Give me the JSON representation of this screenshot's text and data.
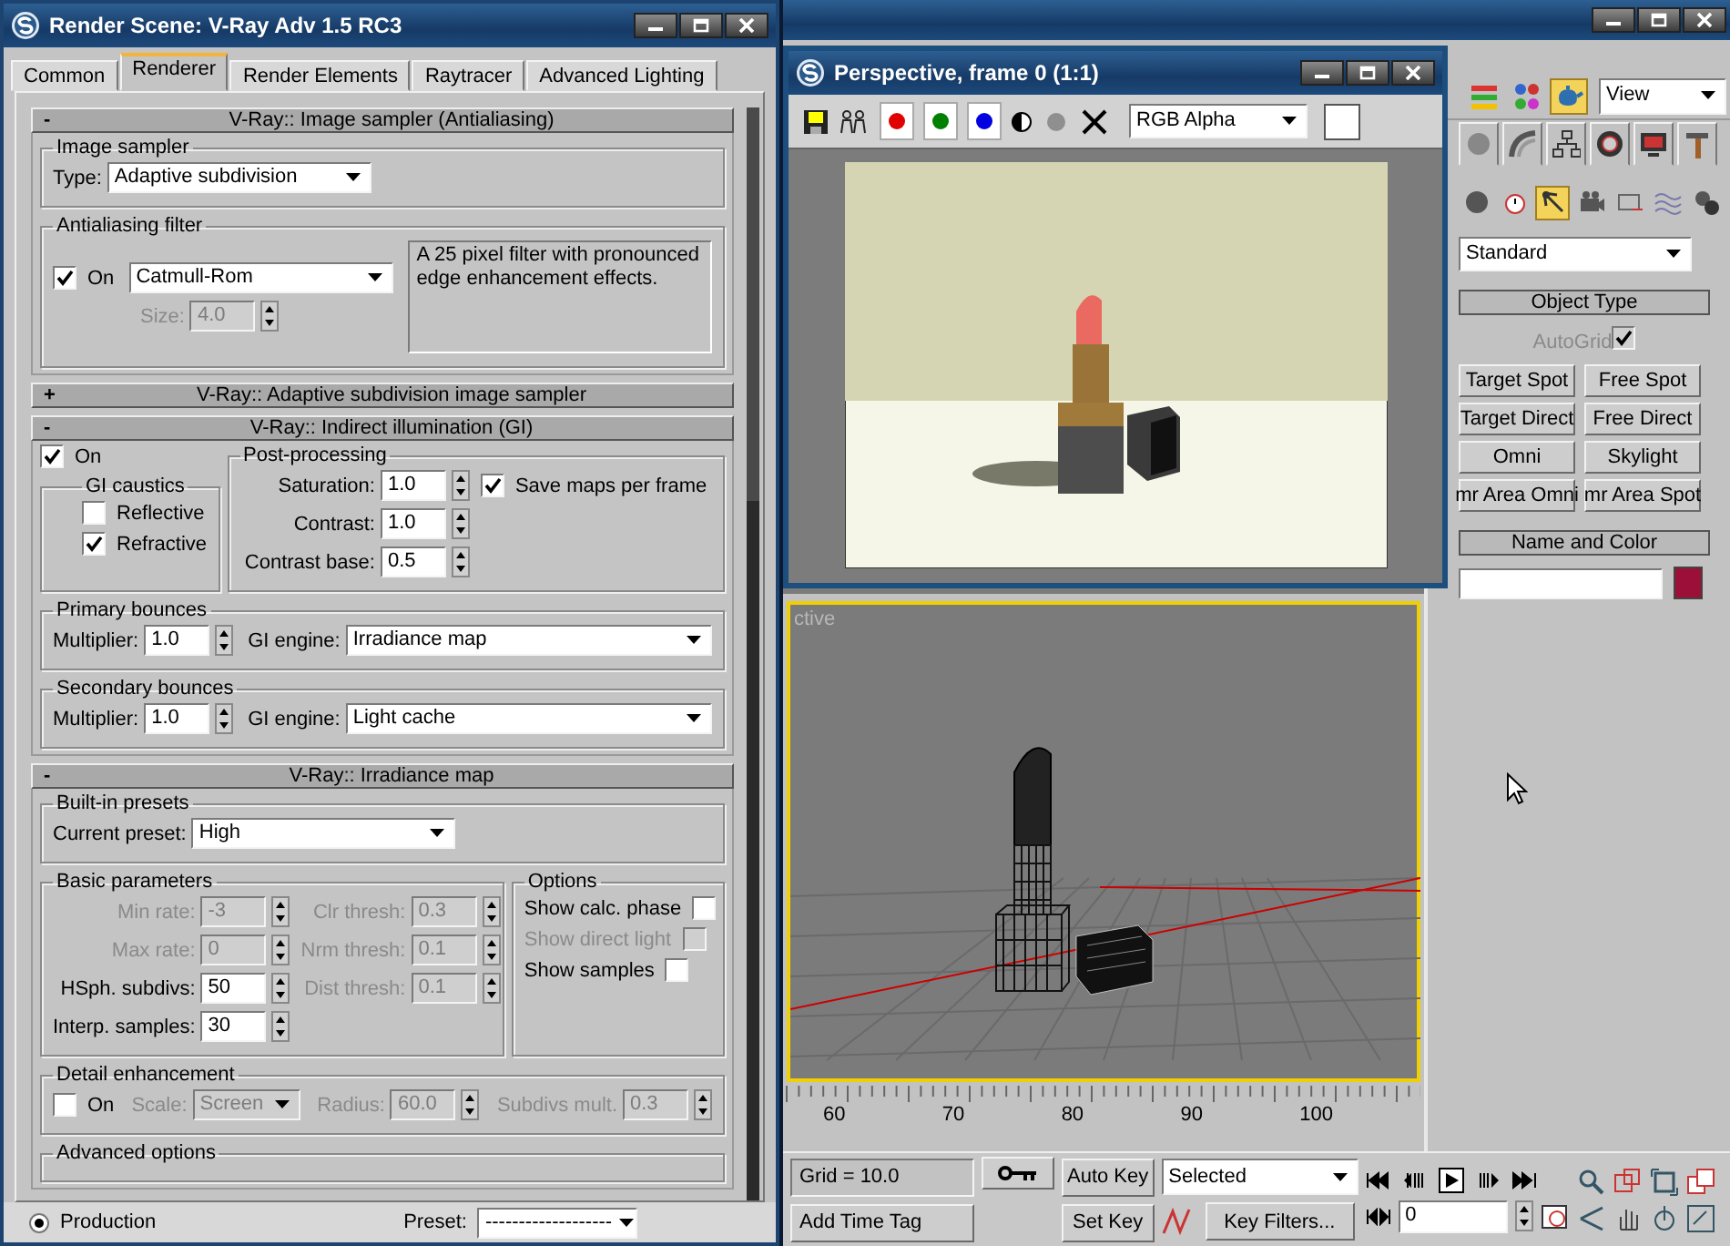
{
  "render_dialog": {
    "title": "Render Scene: V-Ray Adv 1.5 RC3",
    "tabs": [
      {
        "label": "Common",
        "selected": false
      },
      {
        "label": "Renderer",
        "selected": true
      },
      {
        "label": "Render Elements",
        "selected": false
      },
      {
        "label": "Raytracer",
        "selected": false
      },
      {
        "label": "Advanced Lighting",
        "selected": false
      }
    ],
    "rollouts": [
      {
        "toggle": "-",
        "title": "V-Ray:: Image sampler (Antialiasing)",
        "expanded": true,
        "items": [
          {
            "kind": "group",
            "title": "Image sampler",
            "items": [
              {
                "kind": "row",
                "items": [
                  {
                    "kind": "dropdown",
                    "label": "Type:",
                    "value": "Adaptive subdivision",
                    "disabled": false
                  }
                ]
              }
            ]
          },
          {
            "kind": "group",
            "title": "Antialiasing filter",
            "items": [
              {
                "kind": "row",
                "items": [
                  {
                    "kind": "col",
                    "items": [
                      {
                        "kind": "row",
                        "items": [
                          {
                            "kind": "checkbox",
                            "label": "On",
                            "checked": true,
                            "disabled": false
                          },
                          {
                            "kind": "dropdown",
                            "value": "Catmull-Rom",
                            "disabled": false
                          }
                        ]
                      },
                      {
                        "kind": "spinner",
                        "label": "Size:",
                        "value": "4.0",
                        "disabled": true
                      }
                    ]
                  },
                  {
                    "kind": "note",
                    "text": "A 25 pixel filter with pronounced edge enhancement effects."
                  }
                ]
              }
            ]
          }
        ]
      },
      {
        "toggle": "+",
        "title": "V-Ray:: Adaptive subdivision image sampler",
        "expanded": false
      },
      {
        "toggle": "-",
        "title": "V-Ray:: Indirect illumination (GI)",
        "expanded": true,
        "items": [
          {
            "kind": "row",
            "items": [
              {
                "kind": "col",
                "items": [
                  {
                    "kind": "checkbox",
                    "label": "On",
                    "checked": true,
                    "disabled": false
                  },
                  {
                    "kind": "group",
                    "title": "GI caustics",
                    "items": [
                      {
                        "kind": "checkbox",
                        "label": "Reflective",
                        "checked": false,
                        "disabled": false
                      },
                      {
                        "kind": "checkbox",
                        "label": "Refractive",
                        "checked": true,
                        "disabled": false
                      }
                    ]
                  }
                ]
              },
              {
                "kind": "group",
                "title": "Post-processing",
                "items": [
                  {
                    "kind": "grid",
                    "rows": [
                      [
                        {
                          "kind": "spinner",
                          "label": "Saturation:",
                          "value": "1.0",
                          "disabled": false
                        },
                        {
                          "kind": "checkbox",
                          "label": "Save maps per frame",
                          "checked": true,
                          "disabled": false
                        }
                      ],
                      [
                        {
                          "kind": "spinner",
                          "label": "Contrast:",
                          "value": "1.0",
                          "disabled": false
                        }
                      ],
                      [
                        {
                          "kind": "spinner",
                          "label": "Contrast base:",
                          "value": "0.5",
                          "disabled": false
                        }
                      ]
                    ]
                  }
                ]
              }
            ]
          },
          {
            "kind": "group",
            "title": "Primary bounces",
            "items": [
              {
                "kind": "row",
                "items": [
                  {
                    "kind": "spinner",
                    "label": "Multiplier:",
                    "value": "1.0",
                    "disabled": false
                  },
                  {
                    "kind": "dropdown",
                    "label": "GI engine:",
                    "value": "Irradiance map",
                    "disabled": false
                  }
                ]
              }
            ]
          },
          {
            "kind": "group",
            "title": "Secondary bounces",
            "items": [
              {
                "kind": "row",
                "items": [
                  {
                    "kind": "spinner",
                    "label": "Multiplier:",
                    "value": "1.0",
                    "disabled": false
                  },
                  {
                    "kind": "dropdown",
                    "label": "GI engine:",
                    "value": "Light cache",
                    "disabled": false
                  }
                ]
              }
            ]
          }
        ]
      },
      {
        "toggle": "-",
        "title": "V-Ray:: Irradiance map",
        "expanded": true,
        "items": [
          {
            "kind": "group",
            "title": "Built-in presets",
            "items": [
              {
                "kind": "row",
                "items": [
                  {
                    "kind": "dropdown",
                    "label": "Current preset:",
                    "value": "High",
                    "disabled": false
                  }
                ]
              }
            ]
          },
          {
            "kind": "row",
            "items": [
              {
                "kind": "group",
                "title": "Basic parameters",
                "items": [
                  {
                    "kind": "grid",
                    "rows": [
                      [
                        {
                          "kind": "spinner",
                          "label": "Min rate:",
                          "value": "-3",
                          "disabled": true
                        },
                        {
                          "kind": "spinner",
                          "label": "Clr thresh:",
                          "value": "0.3",
                          "disabled": true
                        }
                      ],
                      [
                        {
                          "kind": "spinner",
                          "label": "Max rate:",
                          "value": "0",
                          "disabled": true
                        },
                        {
                          "kind": "spinner",
                          "label": "Nrm thresh:",
                          "value": "0.1",
                          "disabled": true
                        }
                      ],
                      [
                        {
                          "kind": "spinner",
                          "label": "HSph. subdivs:",
                          "value": "50",
                          "disabled": false
                        },
                        {
                          "kind": "spinner",
                          "label": "Dist thresh:",
                          "value": "0.1",
                          "disabled": true
                        }
                      ],
                      [
                        {
                          "kind": "spinner",
                          "label": "Interp. samples:",
                          "value": "30",
                          "disabled": false
                        }
                      ]
                    ]
                  }
                ]
              },
              {
                "kind": "group",
                "title": "Options",
                "items": [
                  {
                    "kind": "grid",
                    "rows": [
                      [
                        {
                          "kind": "option",
                          "label": "Show calc. phase",
                          "checked": false,
                          "disabled": false
                        }
                      ],
                      [
                        {
                          "kind": "option",
                          "label": "Show direct light",
                          "checked": false,
                          "disabled": true
                        }
                      ],
                      [
                        {
                          "kind": "option",
                          "label": "Show samples",
                          "checked": false,
                          "disabled": false
                        }
                      ]
                    ]
                  }
                ]
              }
            ]
          },
          {
            "kind": "group",
            "title": "Detail enhancement",
            "items": [
              {
                "kind": "row",
                "items": [
                  {
                    "kind": "checkbox",
                    "label": "On",
                    "checked": false,
                    "disabled": false
                  },
                  {
                    "kind": "dropdown",
                    "label": "Scale:",
                    "value": "Screen",
                    "disabled": true
                  },
                  {
                    "kind": "spinner",
                    "label": "Radius:",
                    "value": "60.0",
                    "disabled": true
                  },
                  {
                    "kind": "spinner",
                    "label": "Subdivs mult.",
                    "value": "0.3",
                    "disabled": true
                  }
                ]
              }
            ]
          },
          {
            "kind": "group",
            "title": "Advanced options"
          }
        ]
      }
    ],
    "footer": {
      "mode": {
        "label": "Production",
        "selected": true
      },
      "preset": {
        "label": "Preset:",
        "value": "-------------------"
      }
    }
  },
  "frame_window": {
    "title": "Perspective, frame 0 (1:1)",
    "channels": [
      {
        "color": "#e00000",
        "on": true
      },
      {
        "color": "#008000",
        "on": true
      },
      {
        "color": "#0000e0",
        "on": true
      }
    ],
    "display": "RGB Alpha"
  },
  "main_window": {
    "toolbar": {
      "icons": [
        {
          "selected": false
        },
        {
          "selected": false
        },
        {
          "selected": true
        }
      ],
      "view": "View"
    },
    "command_panel": {
      "category_icons": [
        {
          "selected": false
        },
        {
          "selected": false
        },
        {
          "selected": true
        },
        {
          "selected": false
        },
        {
          "selected": false
        },
        {
          "selected": false
        },
        {
          "selected": false
        }
      ],
      "category": "Standard",
      "object_type": {
        "title": "Object Type",
        "autogrid": {
          "label": "AutoGrid",
          "checked": true,
          "disabled": true
        },
        "buttons": [
          "Target Spot",
          "Free Spot",
          "Target Direct",
          "Free Direct",
          "Omni",
          "Skylight",
          "mr Area Omni",
          "mr Area Spot"
        ]
      },
      "name_color": {
        "title": "Name and Color"
      }
    },
    "viewport": {
      "label": "ctive",
      "active": true
    },
    "timeline": {
      "ticks": [
        "60",
        "70",
        "80",
        "90",
        "100"
      ]
    },
    "status": {
      "grid": "Grid = 10.0",
      "time_tag": "Add Time Tag",
      "auto_key": "Auto Key",
      "set_key": "Set Key",
      "key_set": "Selected",
      "key_filters": "Key Filters...",
      "frame": "0"
    }
  }
}
